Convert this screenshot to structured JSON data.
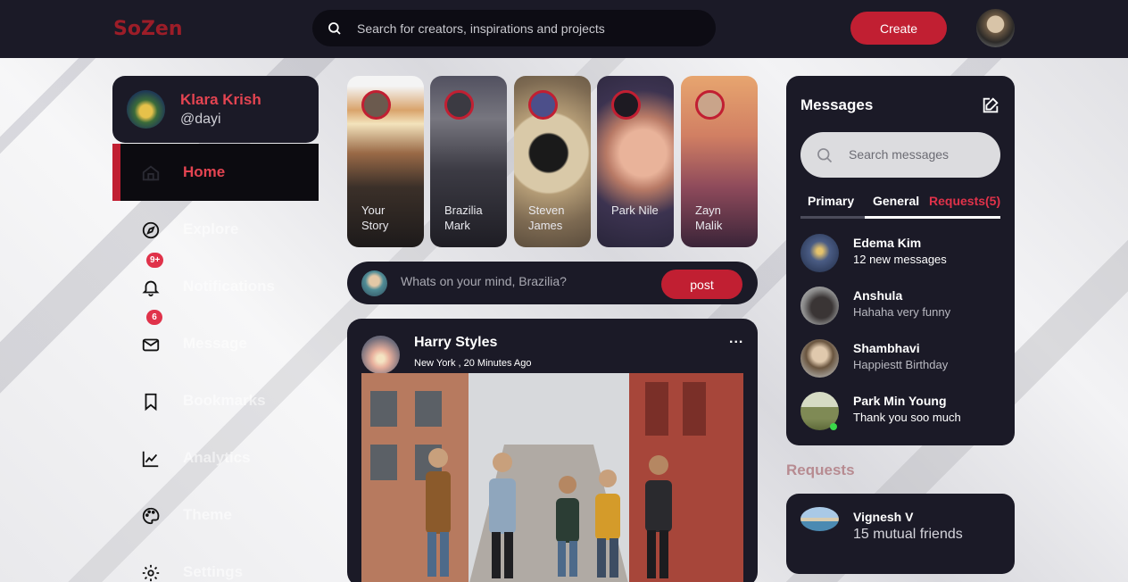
{
  "header": {
    "logo": "SoZen",
    "search_placeholder": "Search for creators, inspirations and projects",
    "create_label": "Create"
  },
  "profile": {
    "name": "Klara Krish",
    "handle": "@dayi"
  },
  "sidebar": {
    "items": [
      {
        "label": "Home",
        "icon": "home-icon",
        "active": true
      },
      {
        "label": "Explore",
        "icon": "compass-icon"
      },
      {
        "label": "Notifications",
        "icon": "bell-icon",
        "badge": "9+"
      },
      {
        "label": "Message",
        "icon": "mail-icon",
        "badge": "6"
      },
      {
        "label": "Bookmarks",
        "icon": "bookmark-icon"
      },
      {
        "label": "Analytics",
        "icon": "chart-icon"
      },
      {
        "label": "Theme",
        "icon": "palette-icon"
      },
      {
        "label": "Settings",
        "icon": "gear-icon"
      }
    ]
  },
  "stories": [
    {
      "line1": "Your",
      "line2": "Story"
    },
    {
      "line1": "Brazilia",
      "line2": "Mark"
    },
    {
      "line1": "Steven",
      "line2": "James"
    },
    {
      "line1": "",
      "line2": "Park Nile"
    },
    {
      "line1": "Zayn",
      "line2": "Malik"
    }
  ],
  "composer": {
    "placeholder": "Whats on your mind, Brazilia?",
    "post_label": "post"
  },
  "feed": {
    "author": "Harry Styles",
    "meta": "New York , 20 Minutes Ago",
    "more": "..."
  },
  "messages": {
    "title": "Messages",
    "search_placeholder": "Search messages",
    "tabs": {
      "primary": "Primary",
      "general": "General",
      "requests": "Requests(5)"
    },
    "items": [
      {
        "name": "Edema Kim",
        "text": "12 new messages"
      },
      {
        "name": "Anshula",
        "text": "Hahaha very funny"
      },
      {
        "name": "Shambhavi",
        "text": "Happiestt Birthday"
      },
      {
        "name": "Park Min Young",
        "text": "Thank you soo much"
      }
    ]
  },
  "requests": {
    "title": "Requests",
    "name": "Vignesh V",
    "text": "15 mutual friends"
  },
  "colors": {
    "accent": "#c11f32",
    "panel": "#1b1a27",
    "topbar": "#1b1a27"
  }
}
